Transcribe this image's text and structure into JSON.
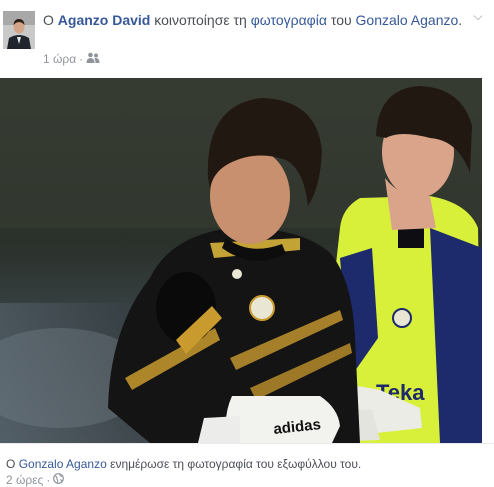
{
  "post": {
    "prefix": "Ο",
    "author": "Aganzo David",
    "action": "κοινοποίησε τη",
    "object": "φωτογραφία",
    "owner_prefix": "του",
    "owner": "Gonzalo Aganzo",
    "suffix": ".",
    "timestamp": "1 ώρα",
    "separator": "·",
    "audience_icon": "friends-icon",
    "options_icon": "chevron-down-icon"
  },
  "shared": {
    "prefix": "Ο",
    "author": "Gonzalo Aganzo",
    "action": "ενημέρωσε τη φωτογραφία του εξωφύλλου του.",
    "timestamp": "2 ώρες",
    "separator": "·",
    "audience_icon": "globe-icon"
  },
  "photo": {
    "jersey_text": "Teka",
    "glove_text": "adidas",
    "shirt_brand": "adidas"
  },
  "colors": {
    "link": "#365899",
    "text": "#4b4f56",
    "meta": "#90949c",
    "keeper_shirt": "#d8f03a",
    "navy": "#1d2a6b"
  }
}
